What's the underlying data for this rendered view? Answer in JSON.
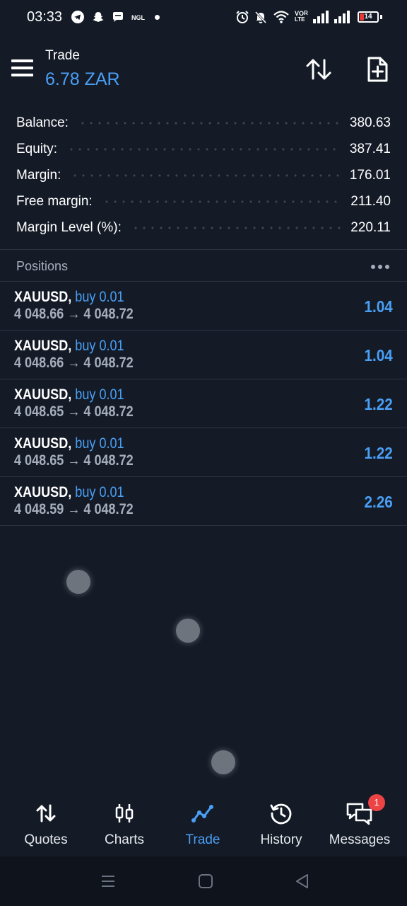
{
  "status_bar": {
    "time": "03:33",
    "ngl": "NGL",
    "network_label_top": "VO",
    "network_label_mid": "LTE",
    "network_label_bot": "R",
    "battery": "14",
    "battery_color": "#e53935"
  },
  "header": {
    "title": "Trade",
    "balance": "6.78 ZAR",
    "accent": "#4a9ff5"
  },
  "summary": [
    {
      "label": "Balance:",
      "value": "380.63"
    },
    {
      "label": "Equity:",
      "value": "387.41"
    },
    {
      "label": "Margin:",
      "value": "176.01"
    },
    {
      "label": "Free margin:",
      "value": "211.40"
    },
    {
      "label": "Margin Level (%):",
      "value": "220.11"
    }
  ],
  "positions": {
    "title": "Positions",
    "more_icon": "more-horizontal-icon",
    "items": [
      {
        "symbol": "XAUUSD,",
        "type": "buy 0.01",
        "prices": "4 048.66 → 4 048.72",
        "profit": "1.04"
      },
      {
        "symbol": "XAUUSD,",
        "type": "buy 0.01",
        "prices": "4 048.66 → 4 048.72",
        "profit": "1.04"
      },
      {
        "symbol": "XAUUSD,",
        "type": "buy 0.01",
        "prices": "4 048.65 → 4 048.72",
        "profit": "1.22"
      },
      {
        "symbol": "XAUUSD,",
        "type": "buy 0.01",
        "prices": "4 048.65 → 4 048.72",
        "profit": "1.22"
      },
      {
        "symbol": "XAUUSD,",
        "type": "buy 0.01",
        "prices": "4 048.59 → 4 048.72",
        "profit": "2.26"
      }
    ]
  },
  "bottom_nav": {
    "items": [
      {
        "label": "Quotes",
        "icon": "quotes-arrows-icon"
      },
      {
        "label": "Charts",
        "icon": "candlestick-chart-icon"
      },
      {
        "label": "Trade",
        "icon": "trade-line-chart-icon",
        "active": true
      },
      {
        "label": "History",
        "icon": "history-clock-icon"
      },
      {
        "label": "Messages",
        "icon": "messages-chat-icon",
        "badge": "1"
      }
    ]
  }
}
